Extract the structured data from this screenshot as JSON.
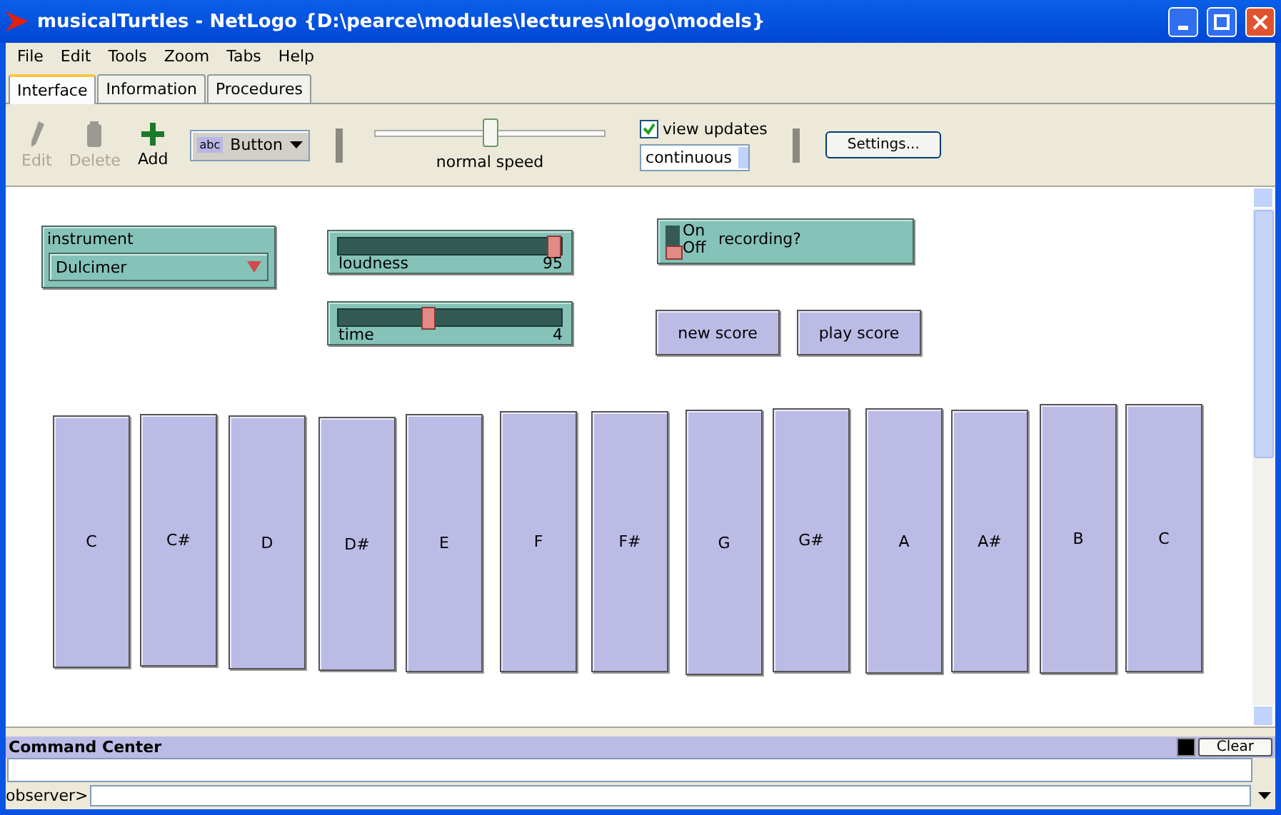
{
  "window": {
    "title": "musicalTurtles - NetLogo {D:\\pearce\\modules\\lectures\\nlogo\\models}"
  },
  "menu": [
    "File",
    "Edit",
    "Tools",
    "Zoom",
    "Tabs",
    "Help"
  ],
  "tabs": [
    {
      "label": "Interface",
      "selected": true
    },
    {
      "label": "Information",
      "selected": false
    },
    {
      "label": "Procedures",
      "selected": false
    }
  ],
  "toolbar": {
    "tools": [
      {
        "label": "Edit",
        "disabled": true,
        "kind": "pencil"
      },
      {
        "label": "Delete",
        "disabled": true,
        "kind": "trash"
      },
      {
        "label": "Add",
        "disabled": false,
        "kind": "plus"
      }
    ],
    "widget_type_icon": "abc",
    "widget_type": "Button",
    "speed": {
      "label": "normal speed",
      "level": 0.5
    },
    "view_updates": {
      "label": "view updates",
      "checked": true
    },
    "update_mode": "continuous",
    "settings": "Settings..."
  },
  "interface": {
    "chooser": {
      "label": "instrument",
      "value": "Dulcimer"
    },
    "sliders": [
      {
        "label": "loudness",
        "value": "95",
        "level": 0.96
      },
      {
        "label": "time",
        "value": "4",
        "level": 0.4
      }
    ],
    "switch": {
      "on_label": "On",
      "off_label": "Off",
      "label": "recording?",
      "on": false
    },
    "buttons": [
      "new score",
      "play score"
    ],
    "keys": [
      "C",
      "C#",
      "D",
      "D#",
      "E",
      "F",
      "F#",
      "G",
      "G#",
      "A",
      "A#",
      "B",
      "C"
    ]
  },
  "command_center": {
    "title": "Command Center",
    "clear": "Clear",
    "prompt": "observer>"
  }
}
